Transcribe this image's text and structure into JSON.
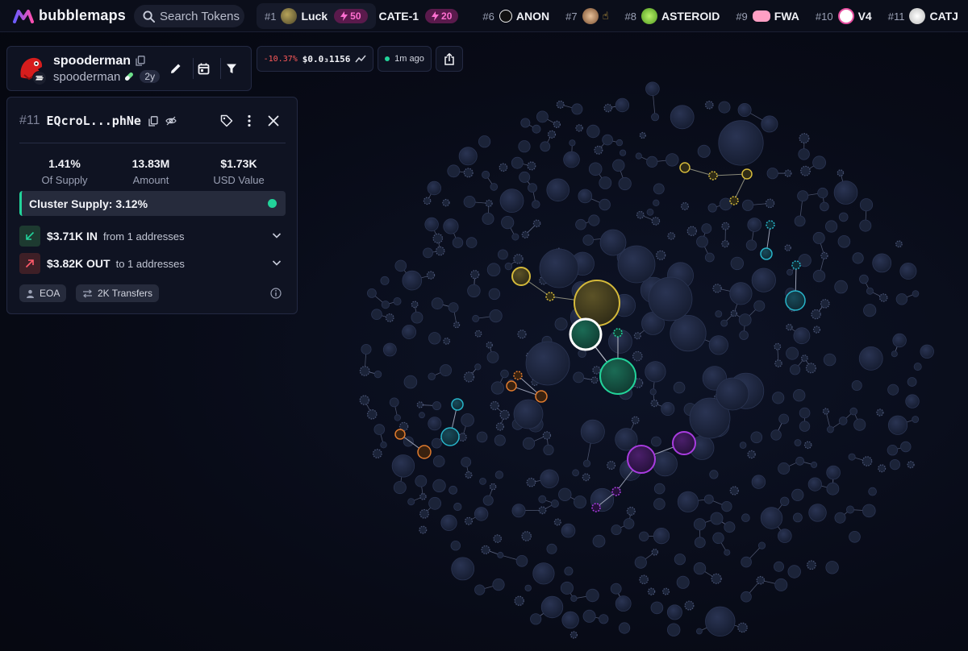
{
  "app": {
    "name": "bubblemaps"
  },
  "search": {
    "label": "Search Tokens"
  },
  "trending": [
    {
      "rank": "#1",
      "name": "Luck",
      "boost": "50",
      "icon_color": "#6b6a3b",
      "highlight": true
    },
    {
      "rank": "",
      "name": "CATE-1",
      "boost": "20",
      "icon_color": "",
      "highlight": false
    },
    {
      "rank": "#6",
      "name": "ANON",
      "boost": "",
      "icon_color": "#111111",
      "highlight": false
    },
    {
      "rank": "#7",
      "name": "",
      "boost": "",
      "icon_color": "#c78a4e",
      "highlight": false
    },
    {
      "rank": "#8",
      "name": "ASTEROID",
      "boost": "",
      "icon_color": "#8fd64a",
      "highlight": false
    },
    {
      "rank": "#9",
      "name": "FWA",
      "boost": "",
      "icon_color": "#ff8fb8",
      "highlight": false
    },
    {
      "rank": "#10",
      "name": "V4",
      "boost": "",
      "icon_color": "#ffffff",
      "highlight": false
    },
    {
      "rank": "#11",
      "name": "CATJ",
      "boost": "",
      "icon_color": "#e8e8e8",
      "highlight": false
    }
  ],
  "token": {
    "name": "spooderman",
    "symbol": "spooderman",
    "age": "2y"
  },
  "price": {
    "change": "-10.37%",
    "value": "$0.0₃1156"
  },
  "live": {
    "label": "1m ago"
  },
  "wallet": {
    "rank": "#11",
    "address": "EQcroL...phNe",
    "stats": [
      {
        "value": "1.41%",
        "label": "Of Supply"
      },
      {
        "value": "13.83M",
        "label": "Amount"
      },
      {
        "value": "$1.73K",
        "label": "USD Value"
      }
    ],
    "cluster_supply": "Cluster Supply: 3.12%",
    "inflow": {
      "value": "$3.71K IN",
      "text": "from 1 addresses"
    },
    "outflow": {
      "value": "$3.82K OUT",
      "text": "to 1 addresses"
    },
    "tags": {
      "type": "EOA",
      "transfers": "2K Transfers"
    }
  },
  "colors": {
    "accent_green": "#22d39a",
    "cluster_yellow": "#d4b93a",
    "cluster_cyan": "#27b4c9",
    "cluster_orange": "#e07b2e",
    "cluster_purple": "#a93ce0",
    "bubble_default": "#1a2238"
  }
}
